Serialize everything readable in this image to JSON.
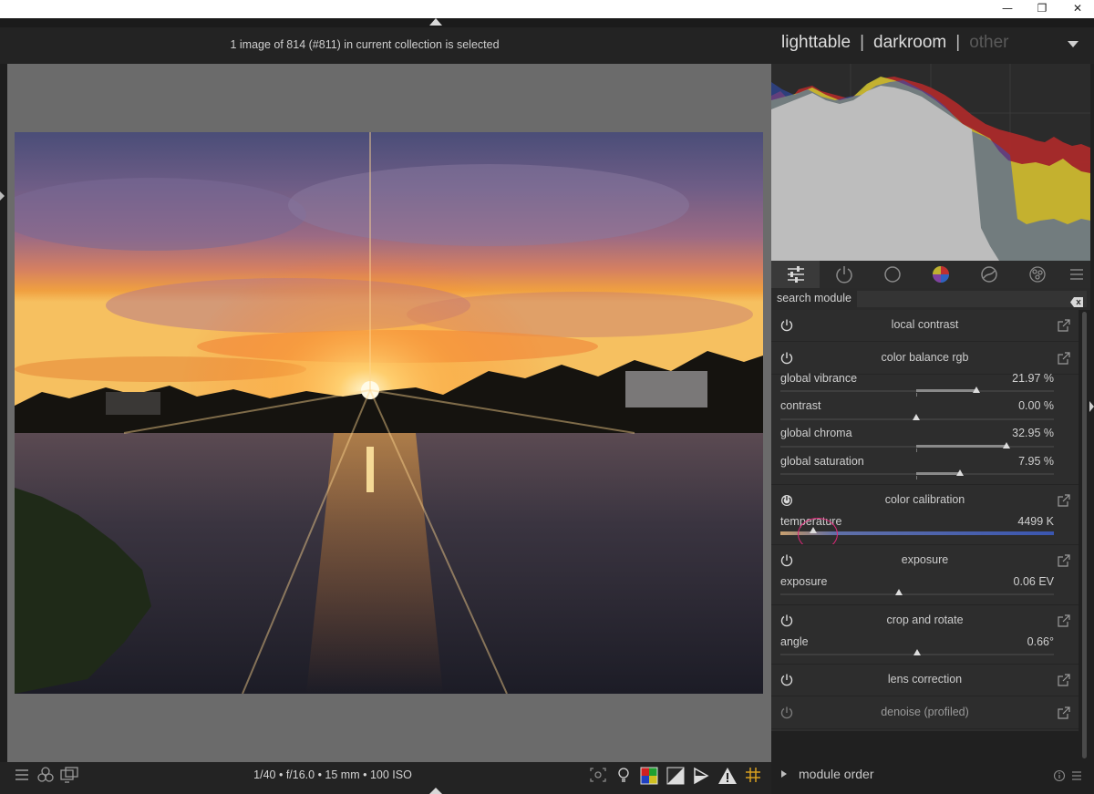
{
  "window": {
    "minimize_glyph": "—",
    "restore_glyph": "❐",
    "close_glyph": "✕"
  },
  "header": {
    "status": "1 image of 814 (#811) in current collection is selected",
    "views": [
      {
        "label": "lighttable",
        "active": false
      },
      {
        "label": "darkroom",
        "active": true
      },
      {
        "label": "other",
        "active": false
      }
    ],
    "separator": "|"
  },
  "footer": {
    "exif": "1/40 • f/16.0 • 15 mm • 100 ISO",
    "module_order": "module order"
  },
  "search": {
    "label": "search module",
    "value": "",
    "placeholder": ""
  },
  "tabs": [
    {
      "name": "active-modules-tab",
      "icon": "sliders-icon",
      "active": true
    },
    {
      "name": "base-modules-tab",
      "icon": "power-icon",
      "active": false
    },
    {
      "name": "tone-modules-tab",
      "icon": "circle-icon",
      "active": false
    },
    {
      "name": "color-modules-tab",
      "icon": "color-wheel-icon",
      "active": false
    },
    {
      "name": "correct-modules-tab",
      "icon": "correct-icon",
      "active": false
    },
    {
      "name": "effect-modules-tab",
      "icon": "effect-icon",
      "active": false
    },
    {
      "name": "presets-menu-tab",
      "icon": "hamburger-icon",
      "active": false
    }
  ],
  "modules": {
    "local_contrast": {
      "title": "local contrast"
    },
    "color_balance_rgb": {
      "title": "color balance rgb",
      "params": [
        {
          "label": "global vibrance",
          "value": "21.97 %",
          "level": 0.2197
        },
        {
          "label": "contrast",
          "value": "0.00 %",
          "level": 0.0
        },
        {
          "label": "global chroma",
          "value": "32.95 %",
          "level": 0.3295
        },
        {
          "label": "global saturation",
          "value": "7.95 %",
          "level": 0.0795
        }
      ]
    },
    "color_calibration": {
      "title": "color calibration",
      "params": [
        {
          "label": "temperature",
          "value": "4499 K",
          "level": 0.12
        }
      ]
    },
    "exposure": {
      "title": "exposure",
      "params": [
        {
          "label": "exposure",
          "value": "0.06 EV",
          "level": 0.44
        }
      ]
    },
    "crop_and_rotate": {
      "title": "crop and rotate",
      "params": [
        {
          "label": "angle",
          "value": "0.66°",
          "level": 0.5
        }
      ]
    },
    "lens_correction": {
      "title": "lens correction"
    },
    "denoise_profiled": {
      "title": "denoise (profiled)"
    }
  },
  "colors": {
    "accent_circle": "#e0287a",
    "panel_bg": "#2d2d2d",
    "canvas_bg": "#6b6b6b"
  }
}
